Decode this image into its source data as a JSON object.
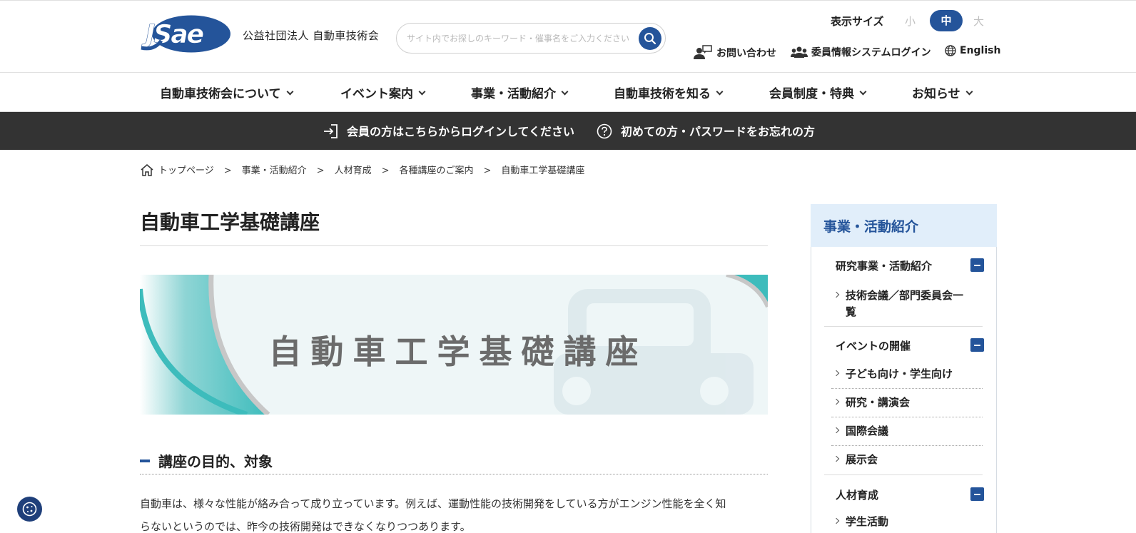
{
  "header": {
    "org_name": "公益社団法人 自動車技術会",
    "search_placeholder": "サイト内でお探しのキーワード・催事名をご入力ください",
    "display_size_label": "表示サイズ",
    "size_options": [
      "小",
      "中",
      "大"
    ],
    "size_selected": "中",
    "utility_links": [
      "お問い合わせ",
      "委員情報システムログイン",
      "English"
    ]
  },
  "nav": {
    "items": [
      "自動車技術会について",
      "イベント案内",
      "事業・活動紹介",
      "自動車技術を知る",
      "会員制度・特典",
      "お知らせ"
    ]
  },
  "login_bar": {
    "member_login": "会員の方はこちらからログインしてください",
    "first_time": "初めての方・パスワードをお忘れの方"
  },
  "breadcrumb": [
    "トップページ",
    "事業・活動紹介",
    "人材育成",
    "各種講座のご案内",
    "自動車工学基礎講座"
  ],
  "breadcrumb_sep": ">",
  "main": {
    "title": "自動車工学基礎講座",
    "banner_text": "自動車工学基礎講座",
    "section_heading": "講座の目的、対象",
    "body_line1": "自動車は、様々な性能が絡み合って成り立っています。例えば、運動性能の技術開発をしている方がエンジン性能を全く知",
    "body_line2": "らないというのでは、昨今の技術開発はできなくなりつつあります。"
  },
  "sidebar": {
    "heading": "事業・活動紹介",
    "groups": [
      {
        "label": "研究事業・活動紹介",
        "items": [
          "技術会議／部門委員会一覧"
        ]
      },
      {
        "label": "イベントの開催",
        "items": [
          "子ども向け・学生向け",
          "研究・講演会",
          "国際会議",
          "展示会"
        ]
      },
      {
        "label": "人材育成",
        "items": [
          "学生活動"
        ]
      }
    ]
  },
  "colors": {
    "brand_blue": "#24549a",
    "dark_bar": "#333333",
    "sidebar_head_bg": "#e1eefa",
    "teal": "#3dbcbc"
  }
}
